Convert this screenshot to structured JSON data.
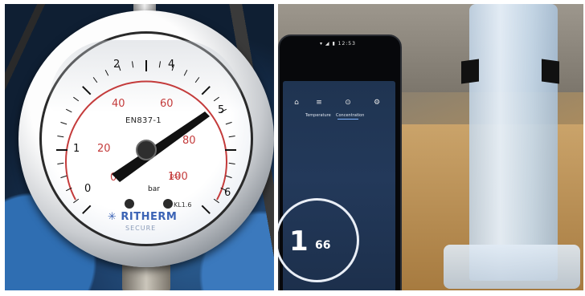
{
  "gauge": {
    "model": "EN837-1",
    "scale_outer": [
      "0",
      "1",
      "2",
      "4",
      "5",
      "6"
    ],
    "scale_inner": [
      "0",
      "20",
      "40",
      "60",
      "80",
      "100"
    ],
    "unit_psi": "psi",
    "unit_bar": "bar",
    "accuracy": "KL1.6",
    "brand": "RITHERM",
    "brand_sub": "SECURE"
  },
  "phone": {
    "status": "▾ ◢ ▮ 12:53",
    "tabs": [
      {
        "icon": "⌂",
        "label": ""
      },
      {
        "icon": "≡",
        "label": "Temperature"
      },
      {
        "icon": "⊙",
        "label": "Concentration"
      },
      {
        "icon": "⚙",
        "label": ""
      }
    ],
    "value_main": "1",
    "value_decimal": "66"
  },
  "colors": {
    "gauge_red": "#c43b3b",
    "gauge_blue": "#3b63b5",
    "screen_bg": "#1f3451"
  }
}
